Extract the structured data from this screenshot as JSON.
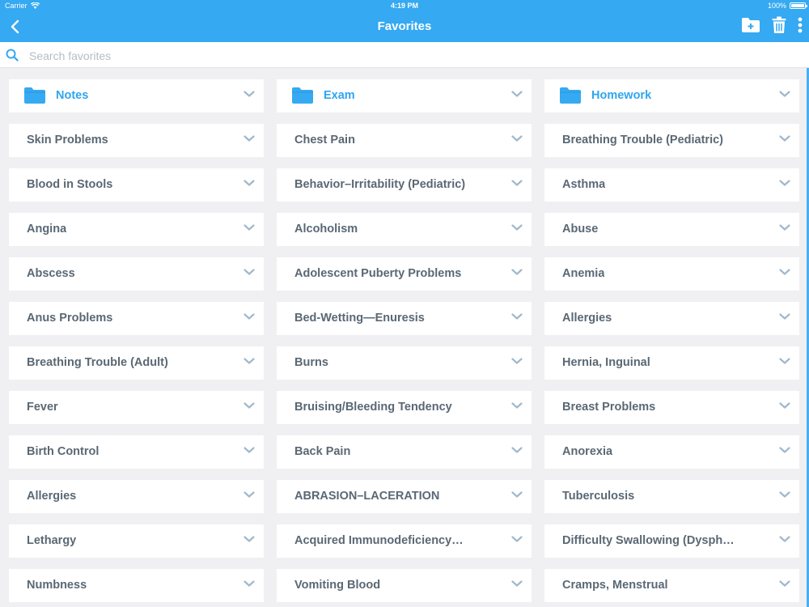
{
  "status": {
    "carrier": "Carrier",
    "time": "4:19 PM",
    "battery": "100%"
  },
  "nav": {
    "title": "Favorites"
  },
  "search": {
    "placeholder": "Search favorites",
    "value": ""
  },
  "colors": {
    "accent": "#35a9f1",
    "folder": "#2fa6ef",
    "text": "#5a6874"
  },
  "icons": {
    "back": "chevron-left-icon",
    "add_folder": "folder-plus-icon",
    "delete": "trash-icon",
    "more": "vertical-ellipsis-icon",
    "search": "search-icon",
    "expand": "chevron-down-icon",
    "folder": "folder-icon"
  },
  "folders": [
    {
      "label": "Notes"
    },
    {
      "label": "Exam"
    },
    {
      "label": "Homework"
    }
  ],
  "items": [
    {
      "label": "Skin Problems"
    },
    {
      "label": "Chest Pain"
    },
    {
      "label": "Breathing Trouble (Pediatric)"
    },
    {
      "label": "Blood in Stools"
    },
    {
      "label": "Behavior–Irritability (Pediatric)"
    },
    {
      "label": "Asthma"
    },
    {
      "label": "Angina"
    },
    {
      "label": "Alcoholism"
    },
    {
      "label": "Abuse"
    },
    {
      "label": "Abscess"
    },
    {
      "label": "Adolescent Puberty Problems"
    },
    {
      "label": "Anemia"
    },
    {
      "label": "Anus Problems"
    },
    {
      "label": "Bed-Wetting—Enuresis"
    },
    {
      "label": "Allergies"
    },
    {
      "label": "Breathing Trouble (Adult)"
    },
    {
      "label": "Burns"
    },
    {
      "label": "Hernia, Inguinal"
    },
    {
      "label": "Fever"
    },
    {
      "label": "Bruising/Bleeding Tendency"
    },
    {
      "label": "Breast Problems"
    },
    {
      "label": "Birth Control"
    },
    {
      "label": "Back Pain"
    },
    {
      "label": "Anorexia"
    },
    {
      "label": "Allergies"
    },
    {
      "label": "ABRASION–LACERATION"
    },
    {
      "label": "Tuberculosis"
    },
    {
      "label": "Lethargy"
    },
    {
      "label": "Acquired Immunodeficiency…"
    },
    {
      "label": "Difficulty Swallowing (Dysph…"
    },
    {
      "label": "Numbness"
    },
    {
      "label": "Vomiting Blood"
    },
    {
      "label": "Cramps, Menstrual"
    }
  ]
}
